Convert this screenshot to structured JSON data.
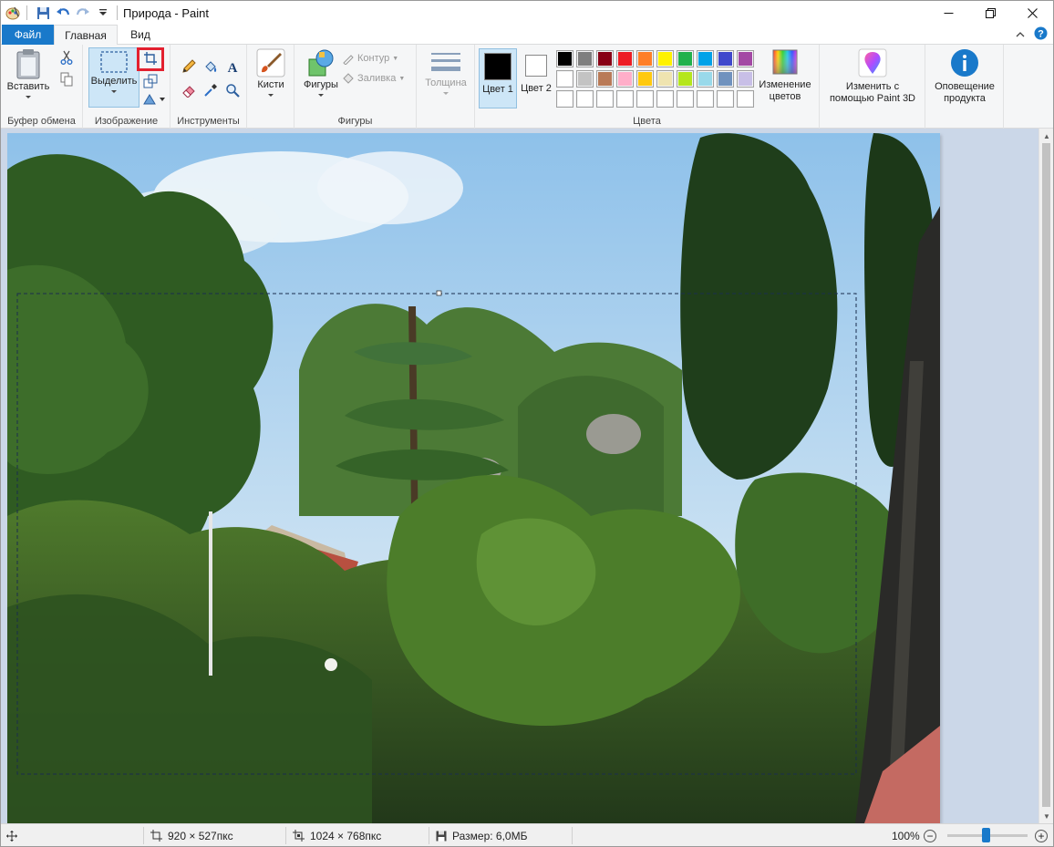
{
  "window": {
    "title": "Природа - Paint"
  },
  "tabs": [
    {
      "label": "Файл"
    },
    {
      "label": "Главная"
    },
    {
      "label": "Вид"
    }
  ],
  "ribbon": {
    "clipboard": {
      "paste_label": "Вставить",
      "group_label": "Буфер обмена"
    },
    "image": {
      "select_label": "Выделить",
      "group_label": "Изображение"
    },
    "tools": {
      "group_label": "Инструменты"
    },
    "brushes": {
      "label": "Кисти"
    },
    "shapes": {
      "shapes_label": "Фигуры",
      "outline_label": "Контур",
      "fill_label": "Заливка",
      "group_label": "Фигуры"
    },
    "size": {
      "label": "Толщина"
    },
    "colors": {
      "color1_label": "Цвет 1",
      "color2_label": "Цвет 2",
      "edit_label": "Изменение цветов",
      "group_label": "Цвета",
      "color1_value": "#000000",
      "color2_value": "#ffffff",
      "palette_row1": [
        "#000000",
        "#7f7f7f",
        "#880015",
        "#ed1c24",
        "#ff7f27",
        "#fff200",
        "#22b14c",
        "#00a2e8",
        "#3f48cc",
        "#a349a4"
      ],
      "palette_row2": [
        "#ffffff",
        "#c3c3c3",
        "#b97a57",
        "#ffaec9",
        "#ffc90e",
        "#efe4b0",
        "#b5e61d",
        "#99d9ea",
        "#7092be",
        "#c8bfe7"
      ],
      "palette_row3": [
        "#ffffff",
        "#ffffff",
        "#ffffff",
        "#ffffff",
        "#ffffff",
        "#ffffff",
        "#ffffff",
        "#ffffff",
        "#ffffff",
        "#ffffff"
      ]
    },
    "paint3d": {
      "label": "Изменить с помощью Paint 3D"
    },
    "notify": {
      "label": "Оповещение продукта"
    }
  },
  "status": {
    "selection_size": "920 × 527пкс",
    "image_size": "1024 × 768пкс",
    "file_size": "Размер: 6,0МБ",
    "zoom": "100%"
  },
  "colors": {
    "accent": "#1979ca",
    "highlight": "#e3202f"
  }
}
